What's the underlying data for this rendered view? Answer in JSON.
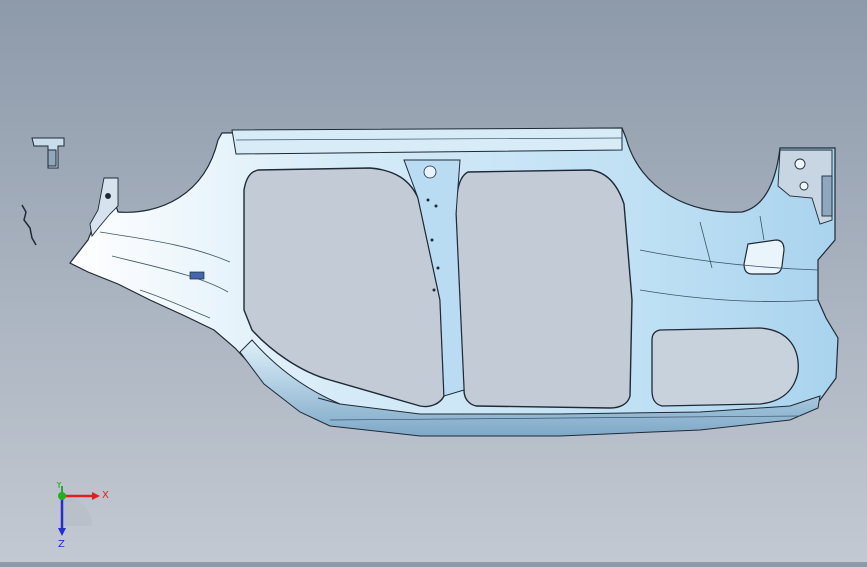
{
  "viewport": {
    "background_top": "#8d9aaa",
    "background_bottom": "#c3c9d2",
    "model": {
      "icon": "car-body-side-panel-3d-model",
      "fill_color": "#cfe6f4",
      "shade_color": "#a9cde6",
      "edge_color": "#1f2a36"
    }
  },
  "triad": {
    "x_label": "X",
    "y_label": "Y",
    "z_label": "Z",
    "x_color": "#e02020",
    "y_color": "#20b020",
    "z_color": "#2030d0"
  }
}
